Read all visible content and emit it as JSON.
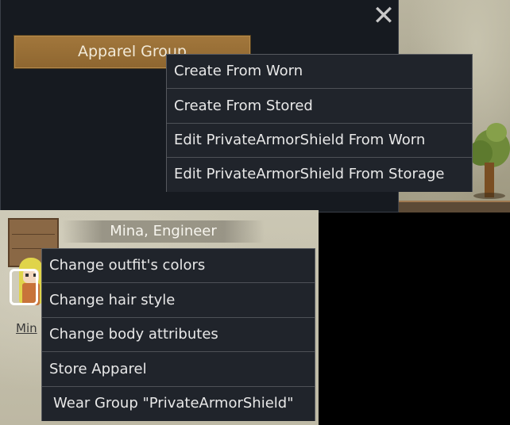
{
  "dialog": {
    "close_icon": "close-x-icon",
    "apparel_group_button": "Apparel Group"
  },
  "group_menu": {
    "items": [
      "Create From Worn",
      "Create From Stored",
      "Edit PrivateArmorShield From Worn",
      "Edit PrivateArmorShield From Storage"
    ]
  },
  "character": {
    "name": "Mina, Engineer",
    "pawn_label": "Min"
  },
  "pawn_menu": {
    "items": [
      "Change outfit's colors",
      "Change hair style",
      "Change body attributes",
      "Store Apparel",
      "Wear Group \"PrivateArmorShield\""
    ]
  }
}
